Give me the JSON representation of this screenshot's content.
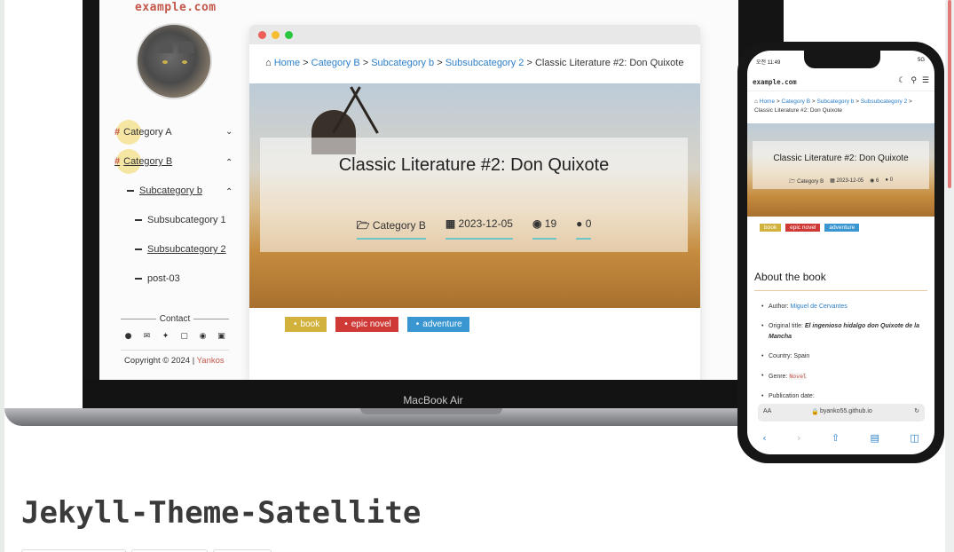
{
  "laptop": {
    "label": "MacBook Air",
    "sidebar": {
      "domain": "example.com",
      "categories": [
        {
          "label": "Category A",
          "expanded": false
        },
        {
          "label": "Category B",
          "expanded": true
        }
      ],
      "subcategory": "Subcategory b",
      "subsub": [
        "Subsubcategory 1",
        "Subsubcategory 2",
        "post-03"
      ],
      "contact_title": "Contact",
      "copyright_prefix": "Copyright © 2024 |",
      "copyright_author": "Yankos"
    },
    "breadcrumb": {
      "items": [
        "Home",
        "Category B",
        "Subcategory b",
        "Subsubcategory 2"
      ],
      "separator": ">",
      "current": "Classic Literature #2: Don Quixote"
    },
    "post": {
      "title": "Classic Literature #2: Don Quixote",
      "category": "Category B",
      "date": "2023-12-05",
      "views": "19",
      "comments": "0"
    },
    "tags": [
      {
        "label": "book",
        "color": "#d2b23c"
      },
      {
        "label": "epic novel",
        "color": "#d03a36"
      },
      {
        "label": "adventure",
        "color": "#3a96d1"
      }
    ]
  },
  "phone": {
    "status_time": "오전 11:49",
    "status_right": "5G",
    "domain": "example.com",
    "breadcrumb_line1": [
      "Home",
      "Category B",
      "Subcategory b",
      "Subsubcategory 2"
    ],
    "breadcrumb_current": "Classic Literature #2: Don Quixote",
    "post": {
      "title": "Classic Literature #2: Don Quixote",
      "category": "Category B",
      "date": "2023-12-05",
      "views": "6",
      "comments": "0"
    },
    "tags": [
      "book",
      "epic novel",
      "adventure"
    ],
    "about_heading": "About the book",
    "details": {
      "author_label": "Author:",
      "author_value": "Miguel de Cervantes",
      "original_label": "Original title:",
      "original_value": "El ingenioso hidalgo don Quixote de la Mancha",
      "country": "Country: Spain",
      "genre_label": "Genre:",
      "genre_value": "Novel",
      "pubdate": "Publication date:"
    },
    "url_aa": "AA",
    "url": "byanko55.github.io"
  },
  "repo_title": "Jekyll-Theme-Satellite",
  "icons": [
    "home-icon",
    "folder-icon",
    "calendar-icon",
    "eye-icon",
    "comment-icon",
    "github-icon",
    "mail-icon",
    "twitter-icon",
    "instagram-icon",
    "facebook-icon",
    "linkedin-icon",
    "moon-icon",
    "search-icon",
    "menu-icon",
    "lock-icon",
    "reload-icon"
  ],
  "colors": {
    "accent": "#c4574a",
    "link": "#2c7fc9",
    "teal_underline": "#6fc6c6"
  }
}
